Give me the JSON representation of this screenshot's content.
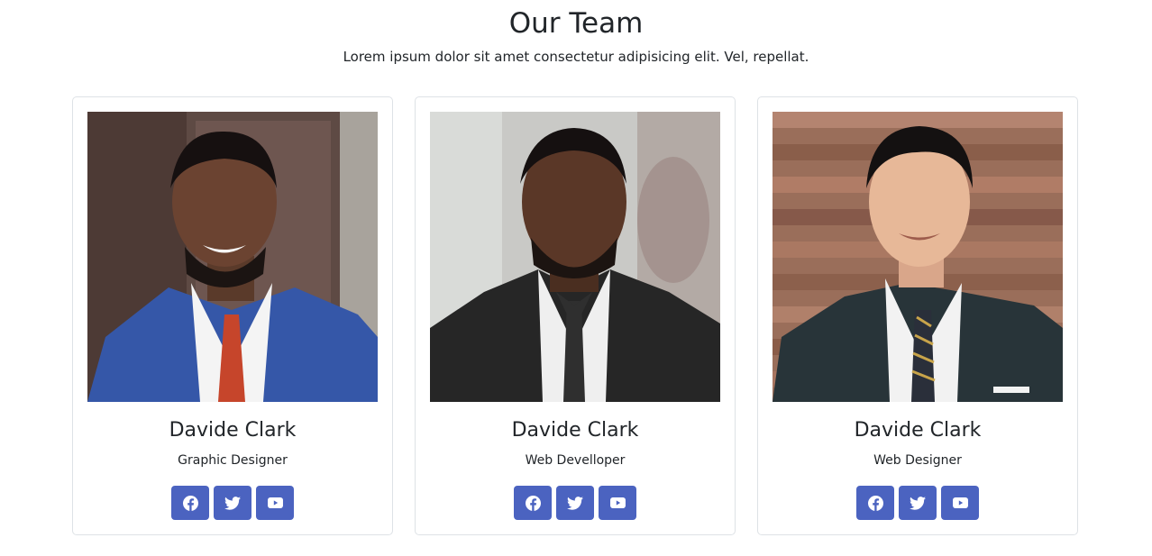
{
  "header": {
    "title": "Our Team",
    "subtitle": "Lorem ipsum dolor sit amet consectetur adipisicing elit. Vel, repellat."
  },
  "team": [
    {
      "name": "Davide Clark",
      "role": "Graphic Designer"
    },
    {
      "name": "Davide Clark",
      "role": "Web Develloper"
    },
    {
      "name": "Davide Clark",
      "role": "Web Designer"
    }
  ],
  "social_icons": [
    "facebook-icon",
    "twitter-icon",
    "youtube-icon"
  ],
  "colors": {
    "button": "#4b63c0",
    "card_border": "#dee2e6",
    "text": "#212529"
  }
}
